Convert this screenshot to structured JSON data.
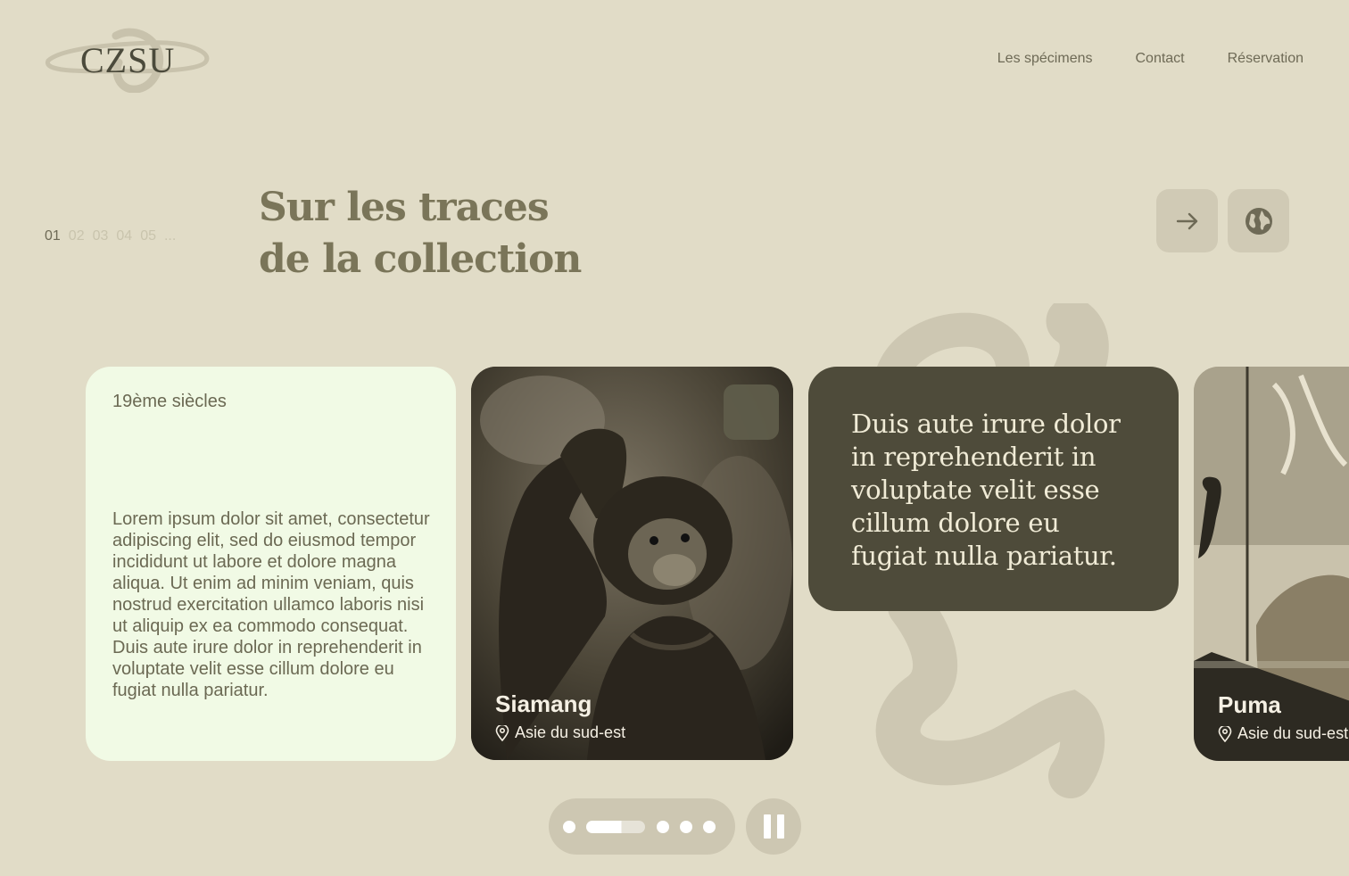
{
  "brand": {
    "logo_text": "CZSU"
  },
  "nav": {
    "items": [
      {
        "label": "Les spécimens"
      },
      {
        "label": "Contact"
      },
      {
        "label": "Réservation"
      }
    ]
  },
  "pager": {
    "numbers": [
      "01",
      "02",
      "03",
      "04",
      "05",
      "..."
    ],
    "active_index": 0
  },
  "hero": {
    "title_line1": "Sur les traces",
    "title_line2": "de la collection"
  },
  "controls": {
    "next_icon": "arrow-right-icon",
    "globe_icon": "globe-icon"
  },
  "cards": {
    "text_card": {
      "era": "19ème siècles",
      "body": "Lorem ipsum dolor sit amet, consectetur adipiscing elit, sed do eiusmod tempor incididunt ut labore et dolore magna aliqua. Ut enim ad minim veniam, quis nostrud exercitation ullamco laboris nisi ut aliquip ex ea commodo consequat. Duis aute irure dolor in reprehenderit in voluptate velit esse cillum dolore eu fugiat nulla pariatur."
    },
    "photo_card": {
      "name": "Siamang",
      "location": "Asie du sud-est",
      "pin_icon": "location-pin-icon"
    },
    "quote_card": {
      "quote": "Duis aute irure dolor in reprehenderit in voluptate velit esse cillum dolore eu fugiat nulla pariatur."
    },
    "puma_card": {
      "name": "Puma",
      "location": "Asie du sud-est",
      "pin_icon": "location-pin-icon"
    }
  },
  "carousel": {
    "slide_count": 5,
    "active_slide": 2,
    "progress_fraction": 0.6,
    "pause_icon": "pause-icon"
  },
  "colors": {
    "background": "#e1dcc7",
    "text_card_bg": "#f1fae5",
    "quote_card_bg": "#4e4b3a",
    "control_bg": "#d0cab5"
  }
}
